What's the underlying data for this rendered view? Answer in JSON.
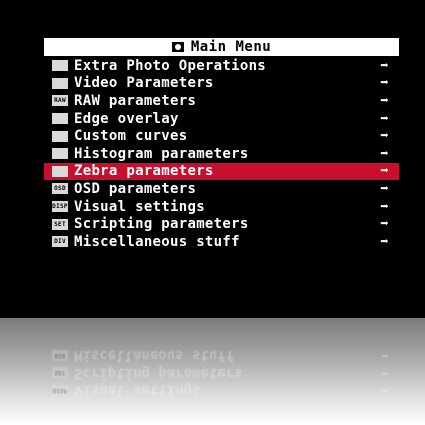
{
  "title": "Main Menu",
  "items": [
    {
      "label": "Extra Photo Operations",
      "icon": "camera-icon",
      "icon_text": "",
      "arrow": "➡"
    },
    {
      "label": "Video Parameters",
      "icon": "video-icon",
      "icon_text": "",
      "arrow": "➡"
    },
    {
      "label": "RAW parameters",
      "icon": "raw-icon",
      "icon_text": "RAW",
      "arrow": "➡"
    },
    {
      "label": "Edge overlay",
      "icon": "edge-overlay-icon",
      "icon_text": "",
      "arrow": "➡"
    },
    {
      "label": "Custom curves",
      "icon": "curves-icon",
      "icon_text": "",
      "arrow": "➡"
    },
    {
      "label": "Histogram parameters",
      "icon": "histogram-icon",
      "icon_text": "",
      "arrow": "➡"
    },
    {
      "label": "Zebra parameters",
      "icon": "zebra-icon",
      "icon_text": "",
      "arrow": "➡",
      "selected": true
    },
    {
      "label": "OSD parameters",
      "icon": "osd-icon",
      "icon_text": "OSD",
      "arrow": "➡"
    },
    {
      "label": "Visual settings",
      "icon": "display-icon",
      "icon_text": "DISP",
      "arrow": "➡"
    },
    {
      "label": "Scripting parameters",
      "icon": "script-icon",
      "icon_text": "SET",
      "arrow": "➡"
    },
    {
      "label": "Miscellaneous stuff",
      "icon": "misc-icon",
      "icon_text": "DIV",
      "arrow": "➡"
    }
  ],
  "colors": {
    "background": "#000000",
    "text": "#ffffff",
    "title_bar": "#ffffff",
    "selection": "#c8102e"
  }
}
